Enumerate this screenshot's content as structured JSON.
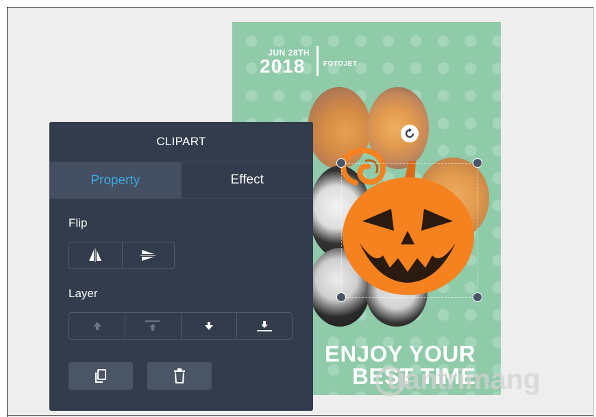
{
  "poster": {
    "date_day": "JUN 28TH",
    "date_year": "2018",
    "brand": "FOTOJET",
    "headline_line1": "ENJOY YOUR",
    "headline_line2": "BEST TIME",
    "background_color": "#8fcaa9"
  },
  "clipart_panel": {
    "title": "CLIPART",
    "tabs": [
      {
        "label": "Property",
        "active": true
      },
      {
        "label": "Effect",
        "active": false
      }
    ],
    "flip_label": "Flip",
    "flip_buttons": [
      {
        "name": "flip-horizontal",
        "icon": "flip-horizontal-icon"
      },
      {
        "name": "flip-vertical",
        "icon": "flip-vertical-icon"
      }
    ],
    "layer_label": "Layer",
    "layer_buttons": [
      {
        "name": "bring-forward",
        "icon": "arrow-up-icon",
        "enabled": false
      },
      {
        "name": "bring-to-front",
        "icon": "arrow-up-to-top-icon",
        "enabled": false
      },
      {
        "name": "send-backward",
        "icon": "arrow-down-icon",
        "enabled": true
      },
      {
        "name": "send-to-back",
        "icon": "arrow-down-to-bottom-icon",
        "enabled": true
      }
    ],
    "action_buttons": [
      {
        "name": "duplicate",
        "icon": "copy-icon"
      },
      {
        "name": "delete",
        "icon": "trash-icon"
      }
    ],
    "colors": {
      "panel_bg": "#323c4d",
      "active_tab_bg": "#444f61",
      "active_tab_text": "#3aa8e0"
    }
  },
  "clipart": {
    "name": "pumpkin-icon",
    "color": "#f5821f"
  },
  "watermark": {
    "text": "uantrimang"
  }
}
